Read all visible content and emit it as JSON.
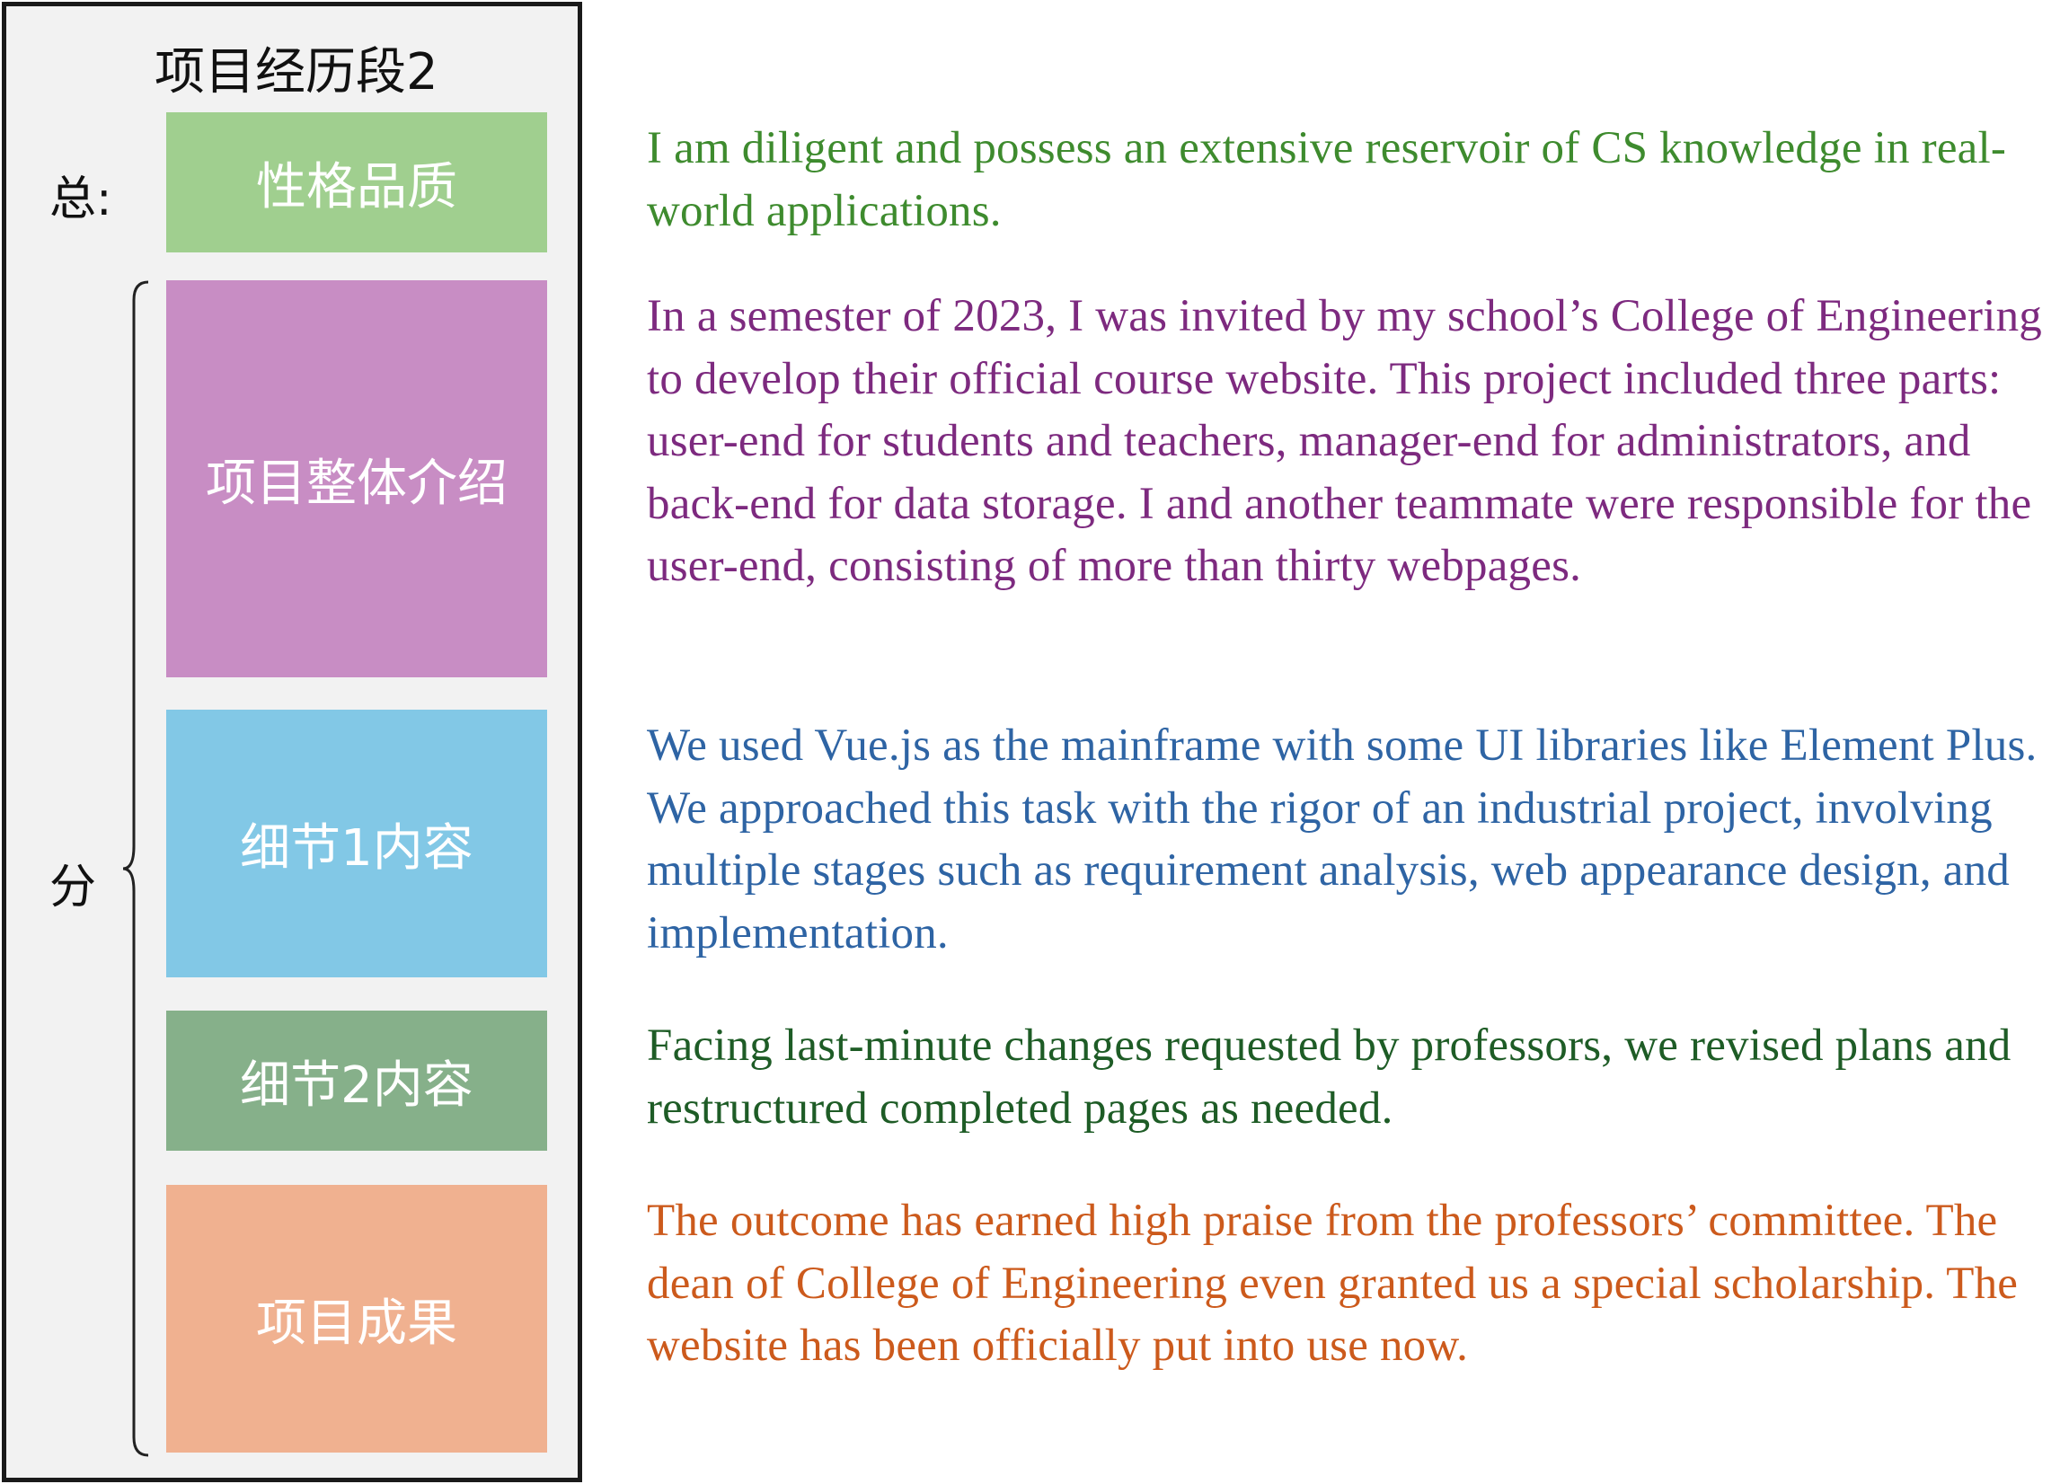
{
  "panel": {
    "title": "项目经历段2",
    "label_total": "总:",
    "label_parts": "分"
  },
  "blocks": [
    {
      "label": "性格品质",
      "color": "#a0cf8f"
    },
    {
      "label": "项目整体介绍",
      "color": "#c88dc4"
    },
    {
      "label": "细节1内容",
      "color": "#82c8e6"
    },
    {
      "label": "细节2内容",
      "color": "#86b08a"
    },
    {
      "label": "项目成果",
      "color": "#f0b190"
    }
  ],
  "paragraphs": [
    {
      "text": "I am diligent and possess an extensive reservoir of CS knowledge in real-world applications.",
      "color": "#3e8b2e"
    },
    {
      "text": "In a semester of 2023, I was invited by my school’s College of Engineering to develop their official course website. This project included three parts: user-end for students and teachers, manager-end for administrators, and back-end for data storage. I and another teammate were responsible for the user-end, consisting of more than thirty webpages.",
      "color": "#7d2a7f"
    },
    {
      "text": "We used Vue.js as the mainframe with some UI libraries like Element Plus. We approached this task with the rigor of an industrial project, involving multiple stages such as requirement analysis, web appearance design, and implementation.",
      "color": "#2e64a4"
    },
    {
      "text": "Facing last-minute changes requested by professors, we revised plans and restructured completed pages as needed.",
      "color": "#1e5c26"
    },
    {
      "text": "The outcome has earned high praise from the professors’ committee. The dean of College of Engineering even granted us a special scholarship. The website has been officially put into use now.",
      "color": "#cc5a1c"
    }
  ]
}
